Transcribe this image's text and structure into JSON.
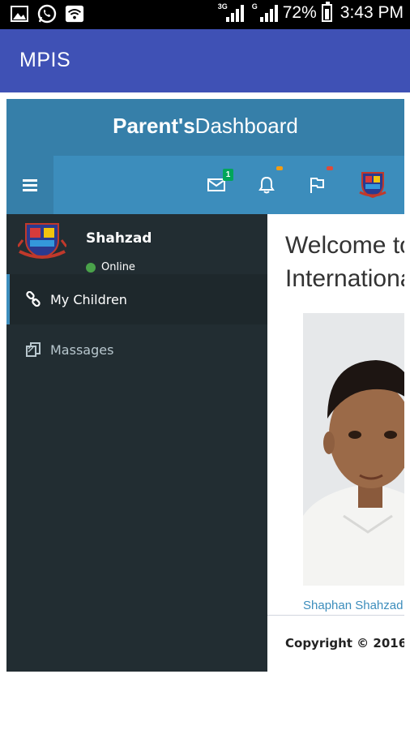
{
  "status_bar": {
    "icons": [
      "gallery-icon",
      "whatsapp-icon",
      "wifi-icon"
    ],
    "sim1_tag": "3G",
    "sim2_tag": "G",
    "battery": "72%",
    "time": "3:43 PM"
  },
  "app_bar": {
    "title": "MPIS"
  },
  "dashboard": {
    "title_bold": "Parent's",
    "title_rest": "Dashboard"
  },
  "navbar": {
    "messages_count": "1",
    "accent_colors": {
      "bell_dot": "#f39c12",
      "flag_dot": "#dd4b39"
    }
  },
  "sidebar": {
    "user_name": "Shahzad",
    "user_status": "Online",
    "items": [
      {
        "label": "My Children",
        "icon": "link-icon",
        "active": true
      },
      {
        "label": "Massages",
        "icon": "copy-icon",
        "active": false
      }
    ]
  },
  "content": {
    "welcome_line1": "Welcome to",
    "welcome_line2": "International",
    "photo_caption": "Shaphan Shahzad",
    "copyright": "Copyright © 2016"
  },
  "colors": {
    "app_bar": "#3f51b5",
    "header": "#3c8dbc",
    "sidebar": "#222d32"
  }
}
